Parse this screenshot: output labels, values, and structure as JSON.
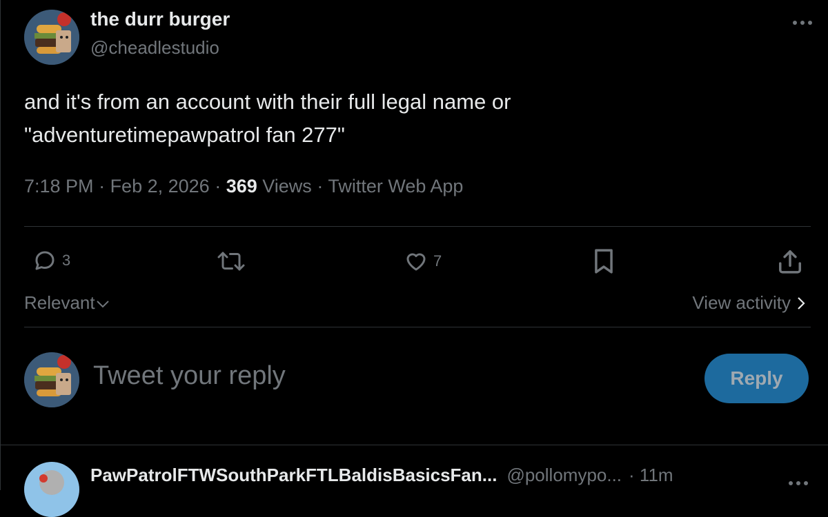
{
  "author": {
    "name": "the durr burger",
    "handle": "@cheadlestudio"
  },
  "tweet": {
    "line1": "and it's from an account with their full legal name or",
    "line2": "\"adventuretimepawpatrol fan 277\"",
    "time": "7:18 PM",
    "separator": " · ",
    "date": "Feb 2, 2026",
    "views_count": "369",
    "views_label": "Views",
    "source": "Twitter Web App"
  },
  "actions": {
    "replies": "3",
    "retweets": "",
    "likes": "7",
    "icons": [
      "reply-icon",
      "retweet-icon",
      "like-icon",
      "bookmark-icon",
      "share-icon"
    ]
  },
  "replies_bar": {
    "sort_label": "Relevant",
    "view_activity": "View activity"
  },
  "composer": {
    "placeholder": "Tweet your reply",
    "button": "Reply"
  },
  "next_reply": {
    "name": "PawPatrolFTWSouthParkFTLBaldisBasicsFan...",
    "handle": "@pollomypo...",
    "time": "· 11m"
  },
  "colors": {
    "background": "#000000",
    "text": "#e7e9ea",
    "muted": "#71767b",
    "divider": "#2f3336",
    "reply_button": "#1d6a9e"
  }
}
